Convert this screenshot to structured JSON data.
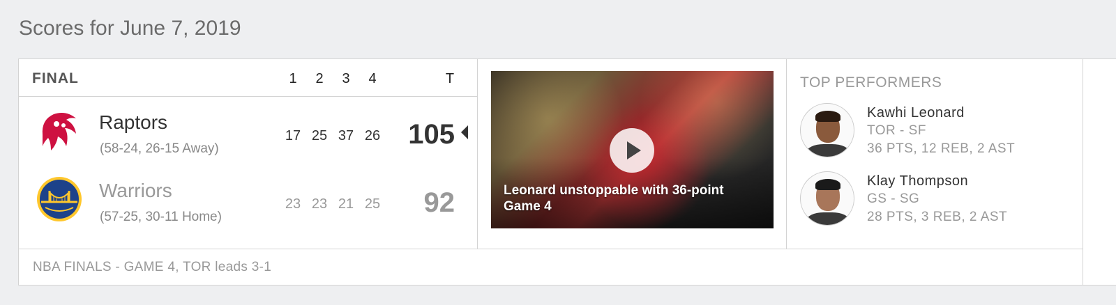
{
  "page_title": "Scores for June 7, 2019",
  "game": {
    "status": "FINAL",
    "quarters": [
      "1",
      "2",
      "3",
      "4"
    ],
    "total_label": "T",
    "teams": [
      {
        "name": "Raptors",
        "record": "(58-24, 26-15 Away)",
        "scores": [
          "17",
          "25",
          "37",
          "26"
        ],
        "total": "105",
        "winner": true,
        "logo": "raptors-logo",
        "color": "#ce1141"
      },
      {
        "name": "Warriors",
        "record": "(57-25, 30-11 Home)",
        "scores": [
          "23",
          "23",
          "21",
          "25"
        ],
        "total": "92",
        "winner": false,
        "logo": "warriors-logo",
        "color": "#1d428a"
      }
    ],
    "footer": "NBA FINALS - GAME 4, TOR leads 3-1"
  },
  "video": {
    "caption": "Leonard unstoppable with 36-point Game 4",
    "icon": "play-icon"
  },
  "performers": {
    "title": "TOP PERFORMERS",
    "items": [
      {
        "name": "Kawhi Leonard",
        "position": "TOR - SF",
        "stats": "36 PTS, 12 REB, 2 AST"
      },
      {
        "name": "Klay Thompson",
        "position": "GS - SG",
        "stats": "28 PTS, 3 REB, 2 AST"
      }
    ]
  },
  "colors": {
    "winner_text": "#333333",
    "loser_text": "#999999",
    "border": "#d3d3d3",
    "background": "#eeeff1"
  }
}
